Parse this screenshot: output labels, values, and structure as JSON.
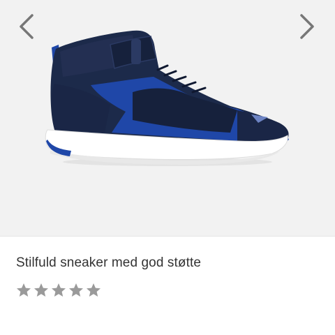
{
  "product": {
    "title": "Stilfuld sneaker med god støtte",
    "image_icon": "sneaker-image"
  },
  "gallery": {
    "prev_icon": "chevron-left-icon",
    "next_icon": "chevron-right-icon",
    "background_color": "#f2f2f2"
  },
  "rating": {
    "stars_total": 5,
    "stars_filled": 0,
    "star_color": "#9a9a9a"
  },
  "colors": {
    "shoe_navy": "#1c2a4a",
    "shoe_blue": "#1f47a8",
    "sole_white": "#ffffff",
    "text": "#333333"
  }
}
